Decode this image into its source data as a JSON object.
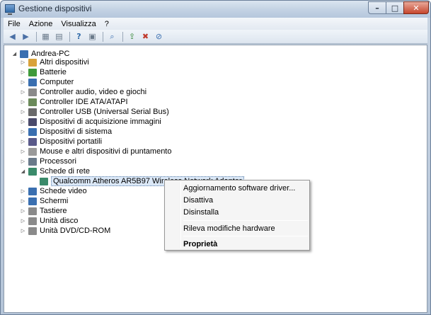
{
  "window": {
    "title": "Gestione dispositivi"
  },
  "menu": [
    "File",
    "Azione",
    "Visualizza",
    "?"
  ],
  "tree": {
    "root": "Andrea-PC",
    "items": [
      {
        "label": "Altri dispositivi",
        "icon": "unknown-device-icon",
        "color": "#d9a23a"
      },
      {
        "label": "Batterie",
        "icon": "battery-icon",
        "color": "#3f9a3a"
      },
      {
        "label": "Computer",
        "icon": "computer-icon",
        "color": "#3a6fb0"
      },
      {
        "label": "Controller audio, video e giochi",
        "icon": "speaker-icon",
        "color": "#8a8a8a"
      },
      {
        "label": "Controller IDE ATA/ATAPI",
        "icon": "ide-controller-icon",
        "color": "#6b8a5a"
      },
      {
        "label": "Controller USB (Universal Serial Bus)",
        "icon": "usb-icon",
        "color": "#6a6a6a"
      },
      {
        "label": "Dispositivi di acquisizione immagini",
        "icon": "camera-icon",
        "color": "#4a4a6a"
      },
      {
        "label": "Dispositivi di sistema",
        "icon": "system-device-icon",
        "color": "#3a6fb0"
      },
      {
        "label": "Dispositivi portatili",
        "icon": "portable-device-icon",
        "color": "#5a5a8a"
      },
      {
        "label": "Mouse e altri dispositivi di puntamento",
        "icon": "mouse-icon",
        "color": "#9a9a9a"
      },
      {
        "label": "Processori",
        "icon": "processor-icon",
        "color": "#6a7a8a"
      },
      {
        "label": "Schede di rete",
        "icon": "network-icon",
        "color": "#3a8a6a"
      },
      {
        "label": "Qualcomm Atheros AR5B97 Wireless Network Adapter",
        "icon": "network-adapter-icon",
        "color": "#3a8a6a"
      },
      {
        "label": "Schede video",
        "icon": "display-adapter-icon",
        "color": "#3a6fb0"
      },
      {
        "label": "Schermi",
        "icon": "monitor-icon",
        "color": "#3a6fb0"
      },
      {
        "label": "Tastiere",
        "icon": "keyboard-icon",
        "color": "#8a8a8a"
      },
      {
        "label": "Unità disco",
        "icon": "disk-drive-icon",
        "color": "#8a8a8a"
      },
      {
        "label": "Unità DVD/CD-ROM",
        "icon": "dvd-drive-icon",
        "color": "#8a8a8a"
      }
    ]
  },
  "context_menu": {
    "update_driver": "Aggiornamento software driver...",
    "disable": "Disattiva",
    "uninstall": "Disinstalla",
    "scan_changes": "Rileva modifiche hardware",
    "properties": "Proprietà"
  }
}
